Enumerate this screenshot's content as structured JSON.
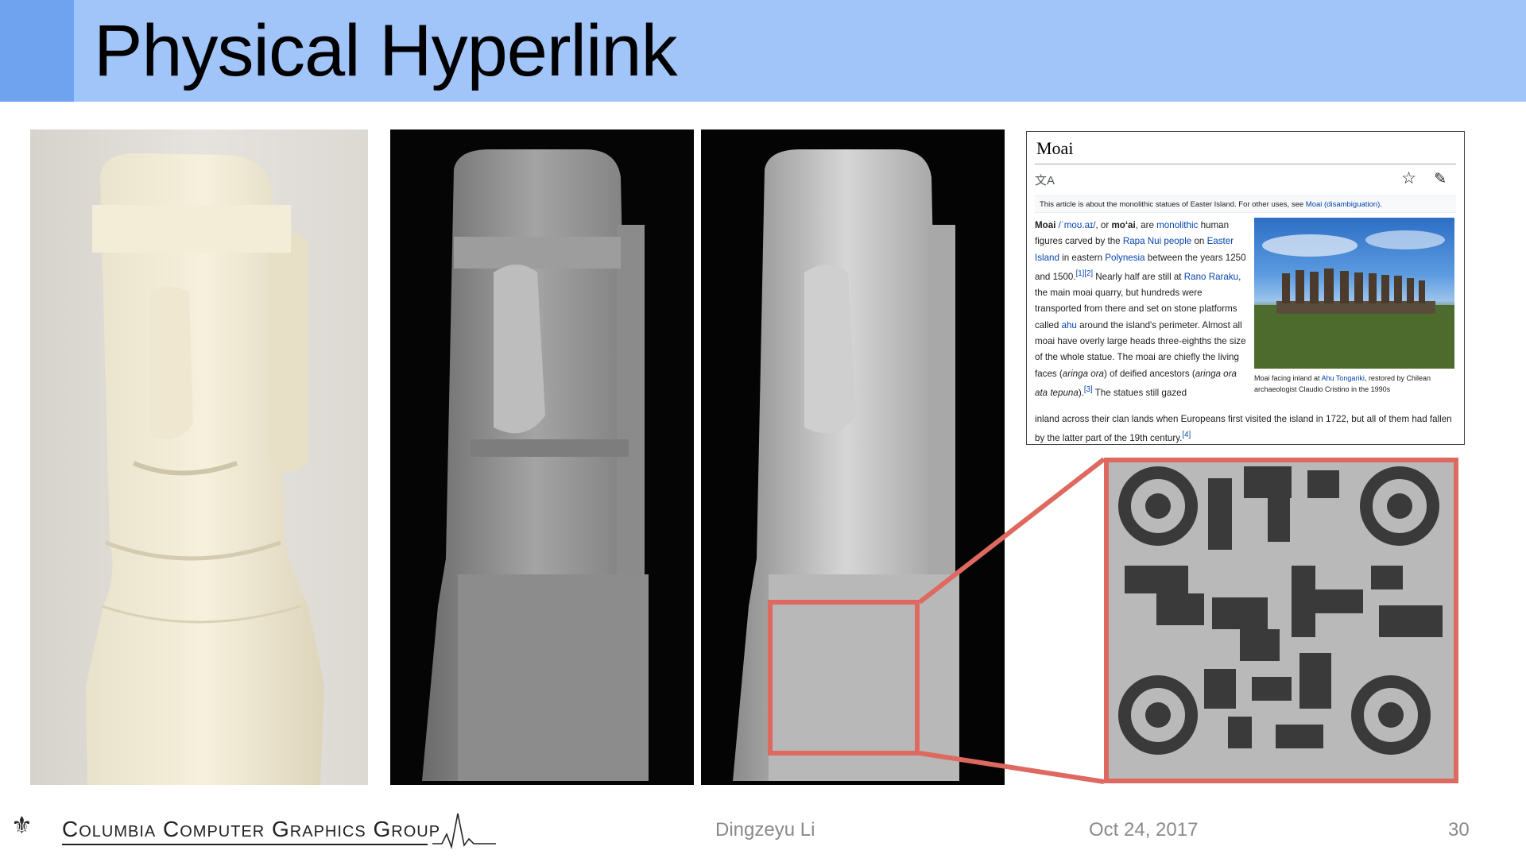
{
  "slide": {
    "title": "Physical Hyperlink",
    "colors": {
      "title_bar": "#a1c4f9",
      "title_accent": "#6fa3ef",
      "zoom_border": "#dd6960"
    }
  },
  "wiki": {
    "title": "Moai",
    "lang_icon": "translate-icon",
    "star_icon": "star-icon",
    "edit_icon": "pencil-icon",
    "hatnote_text": "This article is about the monolithic statues of Easter Island. For other uses, see ",
    "hatnote_link": "Moai (disambiguation)",
    "hatnote_end": ".",
    "body": {
      "t1": "Moai",
      "pron": "/ˈmoʊ.aɪ/",
      "t2": ", or ",
      "t3": "moʻai",
      "t4": ", are ",
      "l1": "monolithic",
      "t5": " human figures carved by the ",
      "l2": "Rapa Nui people",
      "t6": " on ",
      "l3": "Easter Island",
      "t7": " in eastern ",
      "l4": "Polynesia",
      "t8": " between the years 1250 and 1500.",
      "ref1": "[1][2]",
      "t9": " Nearly half are still at ",
      "l5": "Rano Raraku",
      "t10": ", the main moai quarry, but hundreds were transported from there and set on stone platforms called ",
      "l6": "ahu",
      "t11": " around the island's perimeter. Almost all moai have overly large heads three-eighths the size of the whole statue. The moai are chiefly the living faces (",
      "i1": "aringa ora",
      "t12": ") of deified ancestors (",
      "i2": "aringa ora ata tepuna",
      "t13": ").",
      "ref3": "[3]",
      "t14": " The statues still gazed"
    },
    "bottom": {
      "t1": "inland across their clan lands when Europeans first visited the island in 1722, but all of them had fallen by the latter part of the 19th century.",
      "ref4": "[4]"
    },
    "caption": {
      "t1": "Moai facing inland at ",
      "l1": "Ahu Tongariki",
      "t2": ", restored by Chilean archaeologist Claudio Cristino in the 1990s"
    }
  },
  "footer": {
    "logo_text": "Columbia Computer Graphics Group",
    "logo_icon": "lab-crest-icon",
    "author": "Dingzeyu Li",
    "date": "Oct 24, 2017",
    "page": "30"
  }
}
